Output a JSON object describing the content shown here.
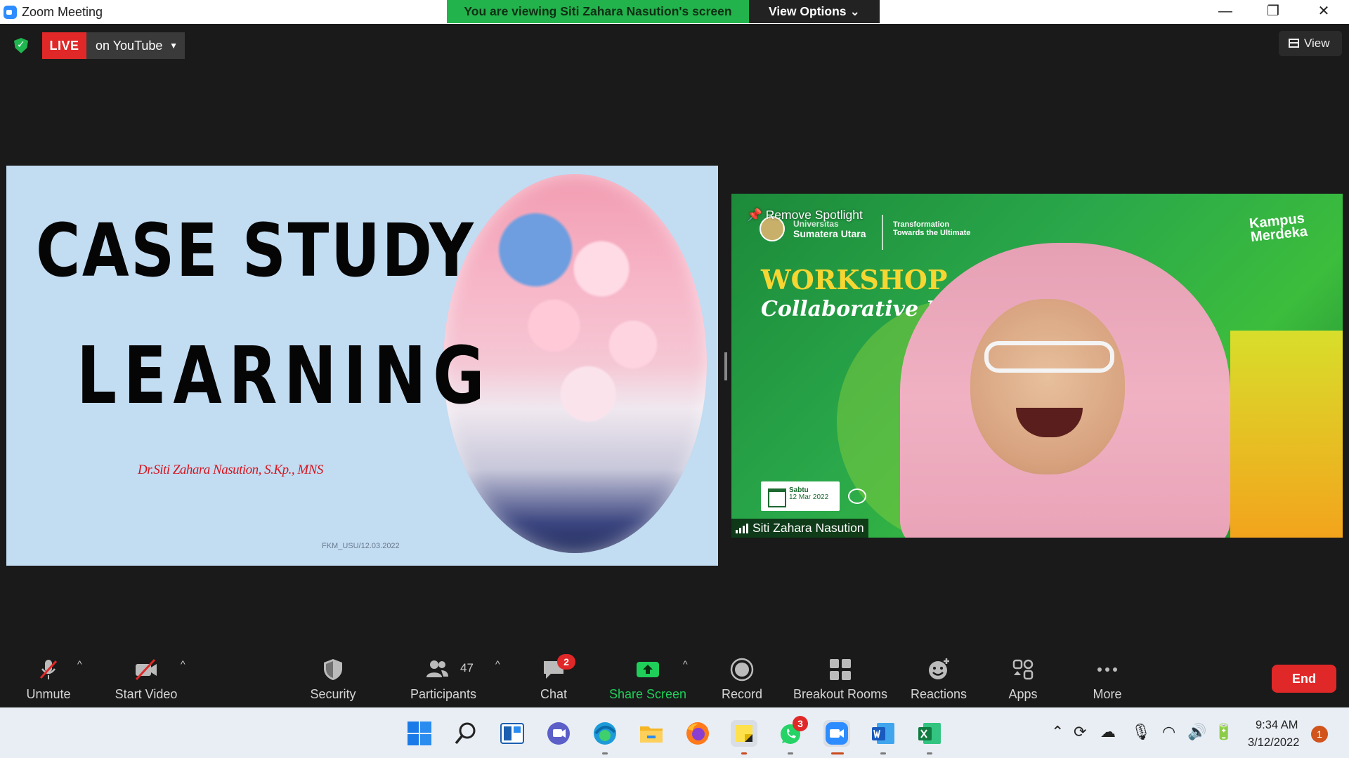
{
  "window": {
    "title": "Zoom Meeting",
    "banner": "You are viewing Siti Zahara Nasution's screen",
    "view_options": "View Options ⌄",
    "minimize": "—",
    "restore": "❐",
    "close": "✕"
  },
  "live": {
    "badge": "LIVE",
    "destination": "on YouTube",
    "caret": "▼"
  },
  "view_button": "View",
  "slide": {
    "title_line1": "CASE STUDY",
    "title_line2": "LEARNING",
    "author": "Dr.Siti Zahara Nasution, S.Kp., MNS",
    "footer": "FKM_USU/12.03.2022"
  },
  "video": {
    "remove_spotlight": "Remove Spotlight",
    "university_line1": "Universitas",
    "university_line2": "Sumatera Utara",
    "tagline_line1": "Transformation",
    "tagline_line2": "Towards the Ultimate",
    "kampus_line1": "Kampus",
    "kampus_line2": "Merdeka",
    "workshop": "WORKSHOP",
    "workshop_sub": "Collaborative Lear",
    "date_line1": "Sabtu",
    "date_line2": "12 Mar 2022",
    "participant_name": "Siti Zahara Nasution"
  },
  "toolbar": {
    "unmute": "Unmute",
    "start_video": "Start Video",
    "security": "Security",
    "participants": "Participants",
    "participants_count": "47",
    "chat": "Chat",
    "chat_badge": "2",
    "share_screen": "Share Screen",
    "record": "Record",
    "breakout_rooms": "Breakout Rooms",
    "reactions": "Reactions",
    "apps": "Apps",
    "more": "More",
    "end": "End",
    "caret": "^"
  },
  "taskbar": {
    "whatsapp_badge": "3",
    "time": "9:34 AM",
    "date": "3/12/2022",
    "notification_count": "1",
    "icons": [
      "windows-start-icon",
      "search-icon",
      "task-view-icon",
      "teams-chat-icon",
      "edge-icon",
      "file-explorer-icon",
      "firefox-icon",
      "sticky-notes-icon",
      "whatsapp-icon",
      "zoom-icon",
      "word-icon",
      "excel-icon"
    ]
  },
  "colors": {
    "accent_green": "#23b34d",
    "live_red": "#e02828",
    "zoom_blue": "#2D8CFF",
    "slide_bg": "#c2dcf2",
    "author_red": "#d6141d"
  }
}
